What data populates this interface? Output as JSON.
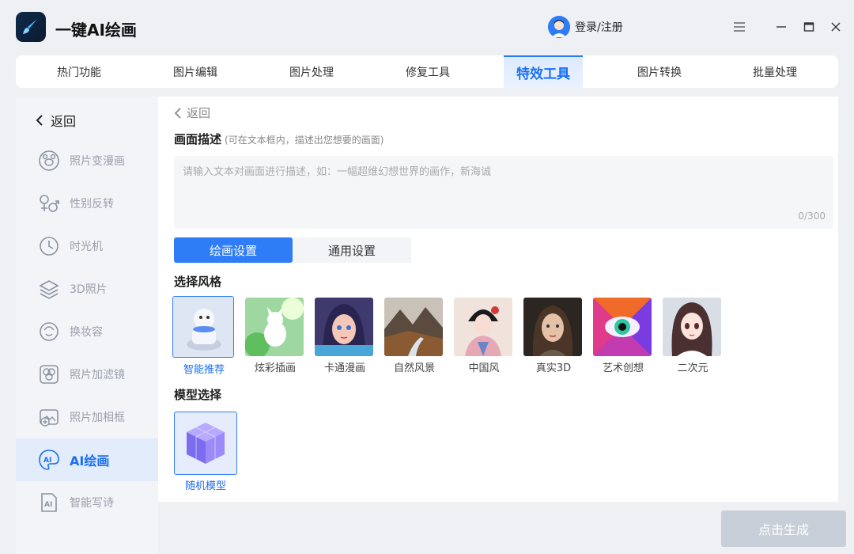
{
  "app": {
    "title": "一键AI绘画"
  },
  "header": {
    "login_label": "登录/注册"
  },
  "topnav": {
    "tabs": [
      {
        "label": "热门功能"
      },
      {
        "label": "图片编辑"
      },
      {
        "label": "图片处理"
      },
      {
        "label": "修复工具"
      },
      {
        "label": "特效工具",
        "active": true
      },
      {
        "label": "图片转换"
      },
      {
        "label": "批量处理"
      }
    ]
  },
  "sidebar": {
    "back_label": "返回",
    "items": [
      {
        "label": "照片变漫画",
        "icon": "bear-face-icon"
      },
      {
        "label": "性别反转",
        "icon": "gender-icon"
      },
      {
        "label": "时光机",
        "icon": "clock-icon"
      },
      {
        "label": "3D照片",
        "icon": "layers-icon"
      },
      {
        "label": "换妆容",
        "icon": "face-makeup-icon"
      },
      {
        "label": "照片加滤镜",
        "icon": "filter-icon"
      },
      {
        "label": "照片加相框",
        "icon": "frame-icon"
      },
      {
        "label": "AI绘画",
        "icon": "ai-paint-icon",
        "active": true
      },
      {
        "label": "智能写诗",
        "icon": "ai-doc-icon"
      }
    ]
  },
  "main": {
    "back_label": "返回",
    "description": {
      "title": "画面描述",
      "hint": "(可在文本框内，描述出您想要的画面)",
      "placeholder": "请输入文本对画面进行描述，如：一幅超维幻想世界的画作，新海诚",
      "value": "",
      "counter": "0/300"
    },
    "settings_tabs": [
      {
        "label": "绘画设置",
        "active": true
      },
      {
        "label": "通用设置"
      }
    ],
    "style_section": {
      "title": "选择风格",
      "styles": [
        {
          "label": "智能推荐",
          "selected": true
        },
        {
          "label": "炫彩插画"
        },
        {
          "label": "卡通漫画"
        },
        {
          "label": "自然风景"
        },
        {
          "label": "中国风"
        },
        {
          "label": "真实3D"
        },
        {
          "label": "艺术创想"
        },
        {
          "label": "二次元"
        }
      ]
    },
    "model_section": {
      "title": "模型选择",
      "models": [
        {
          "label": "随机模型",
          "selected": true
        }
      ]
    }
  },
  "footer": {
    "generate_label": "点击生成"
  },
  "colors": {
    "accent": "#2f7df6",
    "disabled_button": "#c9cfd8",
    "sidebar_active_bg": "#e2ecfb"
  }
}
